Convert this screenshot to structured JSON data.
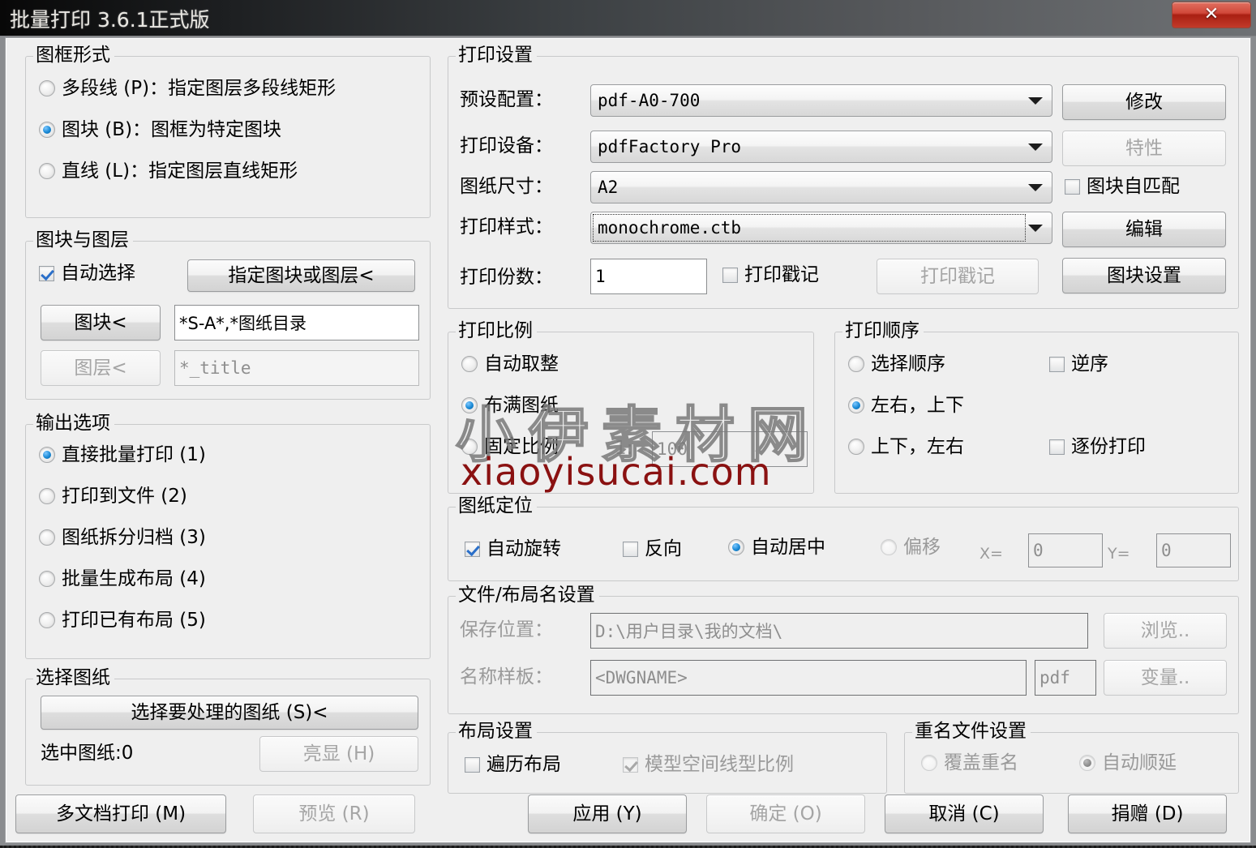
{
  "window": {
    "title": "批量打印 3.6.1正式版",
    "close_glyph": "✕"
  },
  "frame_style": {
    "legend": "图框形式",
    "options": [
      {
        "label": "多段线 (P)：指定图层多段线矩形",
        "selected": false
      },
      {
        "label": "图块 (B)：图框为特定图块",
        "selected": true
      },
      {
        "label": "直线 (L)：指定图层直线矩形",
        "selected": false
      }
    ]
  },
  "block_layer": {
    "legend": "图块与图层",
    "auto_select_label": "自动选择",
    "auto_select_checked": true,
    "specify_button": "指定图块或图层<",
    "block_button": "图块<",
    "block_value": "*S-A*,*图纸目录",
    "layer_button": "图层<",
    "layer_value": "*_title"
  },
  "output_options": {
    "legend": "输出选项",
    "options": [
      {
        "label": "直接批量打印 (1)",
        "selected": true
      },
      {
        "label": "打印到文件 (2)",
        "selected": false
      },
      {
        "label": "图纸拆分归档 (3)",
        "selected": false
      },
      {
        "label": "批量生成布局 (4)",
        "selected": false
      },
      {
        "label": "打印已有布局 (5)",
        "selected": false
      }
    ]
  },
  "select_drawings": {
    "legend": "选择图纸",
    "select_button": "选择要处理的图纸 (S)<",
    "count_label": "选中图纸:0",
    "highlight_button": "亮显 (H)"
  },
  "left_bottom_buttons": {
    "multi_doc": "多文档打印 (M)",
    "preview": "预览 (R)"
  },
  "print_settings": {
    "legend": "打印设置",
    "preset_label": "预设配置：",
    "preset_value": "pdf-A0-700",
    "device_label": "打印设备：",
    "device_value": "pdfFactory Pro",
    "paper_label": "图纸尺寸：",
    "paper_value": "A2",
    "style_label": "打印样式：",
    "style_value": "monochrome.ctb",
    "copies_label": "打印份数：",
    "copies_value": "1",
    "stamp_check_label": "打印戳记",
    "stamp_checked": false,
    "stamp_button": "打印戳记",
    "modify_button": "修改",
    "properties_button": "特性",
    "block_automatch_label": "图块自匹配",
    "block_automatch_checked": false,
    "edit_button": "编辑",
    "block_settings_button": "图块设置"
  },
  "print_scale": {
    "legend": "打印比例",
    "options": [
      {
        "label": "自动取整",
        "selected": false
      },
      {
        "label": "布满图纸",
        "selected": true
      },
      {
        "label": "固定比例",
        "selected": false
      }
    ],
    "ratio_prefix": "1:",
    "ratio_value": "100"
  },
  "print_order": {
    "legend": "打印顺序",
    "options": [
      {
        "label": "选择顺序",
        "selected": false
      },
      {
        "label": "左右，上下",
        "selected": true
      },
      {
        "label": "上下，左右",
        "selected": false
      }
    ],
    "reverse_label": "逆序",
    "reverse_checked": false,
    "collate_label": "逐份打印",
    "collate_checked": false
  },
  "paper_position": {
    "legend": "图纸定位",
    "auto_rotate_label": "自动旋转",
    "auto_rotate_checked": true,
    "reverse_label": "反向",
    "reverse_checked": false,
    "auto_center_label": "自动居中",
    "auto_center_selected": true,
    "offset_label": "偏移",
    "offset_selected": false,
    "x_label": "X=",
    "x_value": "0",
    "y_label": "Y=",
    "y_value": "0"
  },
  "file_layout_name": {
    "legend": "文件/布局名设置",
    "save_path_label": "保存位置：",
    "save_path_value": "D:\\用户目录\\我的文档\\",
    "browse_button": "浏览..",
    "name_template_label": "名称样板：",
    "name_template_value": "<DWGNAME>",
    "ext_value": "pdf",
    "variable_button": "变量.."
  },
  "layout_settings": {
    "legend": "布局设置",
    "traverse_label": "遍历布局",
    "traverse_checked": false,
    "model_ltscale_label": "模型空间线型比例",
    "model_ltscale_checked": true
  },
  "duplicate_settings": {
    "legend": "重名文件设置",
    "overwrite_label": "覆盖重名",
    "overwrite_selected": false,
    "auto_increment_label": "自动顺延",
    "auto_increment_selected": true
  },
  "bottom_buttons": {
    "apply": "应用 (Y)",
    "ok": "确定 (O)",
    "cancel": "取消 (C)",
    "donate": "捐赠 (D)"
  },
  "watermark": {
    "cn": "小伊素材网",
    "en": "xiaoyisucai.com"
  }
}
